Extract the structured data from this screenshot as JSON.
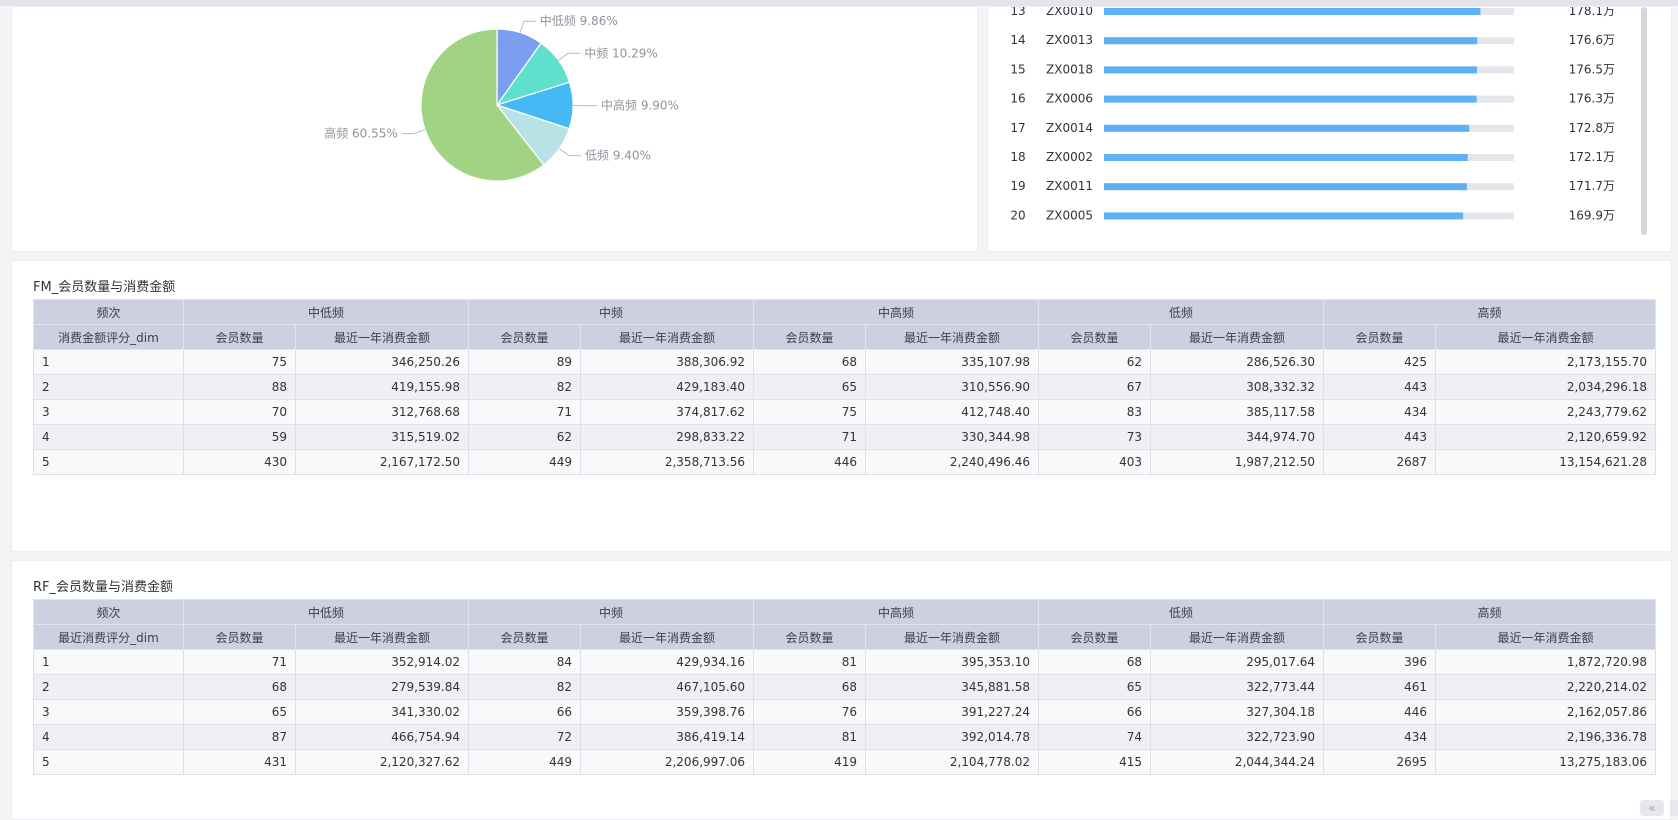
{
  "colors": {
    "pie": [
      "#7c9ef0",
      "#5fe0cc",
      "#45b9f3",
      "#b8e2e6",
      "#a0d482"
    ],
    "bar_fill": "#5fb1f7",
    "bar_track": "#e4e6ec",
    "table_header": "#ccd0e0"
  },
  "chart_data": [
    {
      "type": "pie",
      "slices": [
        {
          "label": "中低频",
          "value": 9.86,
          "display": "中低频 9.86%"
        },
        {
          "label": "中频",
          "value": 10.29,
          "display": "中频 10.29%"
        },
        {
          "label": "中高频",
          "value": 9.9,
          "display": "中高频 9.90%"
        },
        {
          "label": "低频",
          "value": 9.4,
          "display": "低频 9.40%"
        },
        {
          "label": "高频",
          "value": 60.55,
          "display": "高频 60.55%"
        }
      ]
    },
    {
      "type": "bar",
      "orientation": "horizontal",
      "unit": "万",
      "max": 194,
      "rows": [
        {
          "rank": "13",
          "id": "ZX0010",
          "value": 178.1,
          "display": "178.1万"
        },
        {
          "rank": "14",
          "id": "ZX0013",
          "value": 176.6,
          "display": "176.6万"
        },
        {
          "rank": "15",
          "id": "ZX0018",
          "value": 176.5,
          "display": "176.5万"
        },
        {
          "rank": "16",
          "id": "ZX0006",
          "value": 176.3,
          "display": "176.3万"
        },
        {
          "rank": "17",
          "id": "ZX0014",
          "value": 172.8,
          "display": "172.8万"
        },
        {
          "rank": "18",
          "id": "ZX0002",
          "value": 172.1,
          "display": "172.1万"
        },
        {
          "rank": "19",
          "id": "ZX0011",
          "value": 171.7,
          "display": "171.7万"
        },
        {
          "rank": "20",
          "id": "ZX0005",
          "value": 169.9,
          "display": "169.9万"
        }
      ]
    }
  ],
  "fm_table": {
    "title": "FM_会员数量与消费金额",
    "corner_top": "频次",
    "corner_bottom": "消费金额评分_dim",
    "groups": [
      "中低频",
      "中频",
      "中高频",
      "低频",
      "高频"
    ],
    "sub_headers": [
      "会员数量",
      "最近一年消费金额"
    ],
    "rows": [
      [
        "1",
        "75",
        "346,250.26",
        "89",
        "388,306.92",
        "68",
        "335,107.98",
        "62",
        "286,526.30",
        "425",
        "2,173,155.70"
      ],
      [
        "2",
        "88",
        "419,155.98",
        "82",
        "429,183.40",
        "65",
        "310,556.90",
        "67",
        "308,332.32",
        "443",
        "2,034,296.18"
      ],
      [
        "3",
        "70",
        "312,768.68",
        "71",
        "374,817.62",
        "75",
        "412,748.40",
        "83",
        "385,117.58",
        "434",
        "2,243,779.62"
      ],
      [
        "4",
        "59",
        "315,519.02",
        "62",
        "298,833.22",
        "71",
        "330,344.98",
        "73",
        "344,974.70",
        "443",
        "2,120,659.92"
      ],
      [
        "5",
        "430",
        "2,167,172.50",
        "449",
        "2,358,713.56",
        "446",
        "2,240,496.46",
        "403",
        "1,987,212.50",
        "2687",
        "13,154,621.28"
      ]
    ]
  },
  "rf_table": {
    "title": "RF_会员数量与消费金额",
    "corner_top": "频次",
    "corner_bottom": "最近消费评分_dim",
    "groups": [
      "中低频",
      "中频",
      "中高频",
      "低频",
      "高频"
    ],
    "sub_headers": [
      "会员数量",
      "最近一年消费金额"
    ],
    "rows": [
      [
        "1",
        "71",
        "352,914.02",
        "84",
        "429,934.16",
        "81",
        "395,353.10",
        "68",
        "295,017.64",
        "396",
        "1,872,720.98"
      ],
      [
        "2",
        "68",
        "279,539.84",
        "82",
        "467,105.60",
        "68",
        "345,881.58",
        "65",
        "322,773.44",
        "461",
        "2,220,214.02"
      ],
      [
        "3",
        "65",
        "341,330.02",
        "66",
        "359,398.76",
        "76",
        "391,227.24",
        "66",
        "327,304.18",
        "446",
        "2,162,057.86"
      ],
      [
        "4",
        "87",
        "466,754.94",
        "72",
        "386,419.14",
        "81",
        "392,014.78",
        "74",
        "322,723.90",
        "434",
        "2,196,336.78"
      ],
      [
        "5",
        "431",
        "2,120,327.62",
        "449",
        "2,206,997.06",
        "419",
        "2,104,778.02",
        "415",
        "2,044,344.24",
        "2695",
        "13,275,183.06"
      ]
    ]
  },
  "footer": {
    "collapse_glyph": "«"
  }
}
